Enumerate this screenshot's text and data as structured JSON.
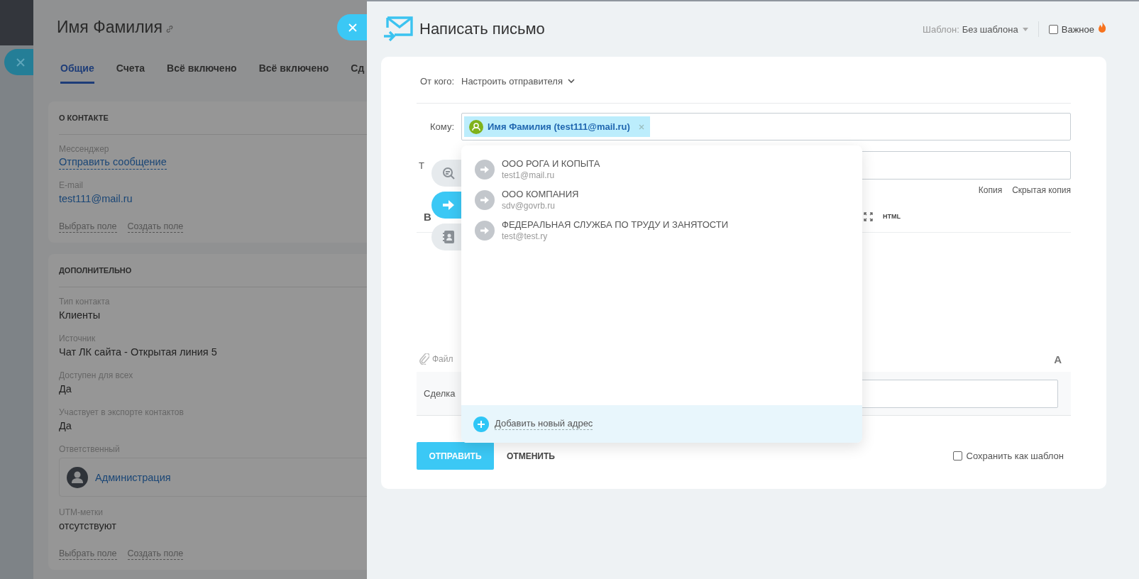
{
  "contact": {
    "title": "Имя Фамилия",
    "tabs": [
      {
        "label": "Общие",
        "selected": true
      },
      {
        "label": "Счета",
        "selected": false
      },
      {
        "label": "Всё включено",
        "selected": false
      },
      {
        "label": "Всё включено",
        "selected": false
      },
      {
        "label": "Сд",
        "selected": false
      }
    ],
    "sections": [
      {
        "title": "О КОНТАКТЕ",
        "fields": [
          {
            "label": "Мессенджер",
            "value": "Отправить сообщение",
            "kind": "action"
          },
          {
            "label": "E-mail",
            "value": "test111@mail.ru",
            "kind": "link"
          }
        ],
        "actions": [
          "Выбрать поле",
          "Создать поле"
        ]
      },
      {
        "title": "ДОПОЛНИТЕЛЬНО",
        "fields": [
          {
            "label": "Тип контакта",
            "value": "Клиенты",
            "kind": "text"
          },
          {
            "label": "Источник",
            "value": "Чат ЛК сайта - Открытая линия 5",
            "kind": "text"
          },
          {
            "label": "Доступен для всех",
            "value": "Да",
            "kind": "text"
          },
          {
            "label": "Участвует в экспорте контактов",
            "value": "Да",
            "kind": "text"
          },
          {
            "label": "Ответственный",
            "value": "Администрация",
            "kind": "user"
          },
          {
            "label": "UTM-метки",
            "value": "отсутствуют",
            "kind": "text"
          }
        ],
        "actions": [
          "Выбрать поле",
          "Создать поле"
        ]
      }
    ]
  },
  "email_form": {
    "title": "Написать письмо",
    "template_label": "Шаблон:",
    "template_value": "Без шаблона",
    "important": {
      "label": "Важное",
      "checked": false
    },
    "from_label": "От кого:",
    "from_value": "Настроить отправителя",
    "to_label": "Кому:",
    "recipients": [
      {
        "name": "Имя Фамилия (test111@mail.ru)"
      }
    ],
    "subject_label": "Т",
    "cc_links": [
      "Копия",
      "Скрытая копия"
    ],
    "toolbar_bold": "B",
    "toolbar_html": "HTML",
    "attach_label": "Файл",
    "font_button": "A",
    "deal_label": "Сделка",
    "send": "ОТПРАВИТЬ",
    "cancel": "ОТМЕНИТЬ",
    "save_template": {
      "label": "Сохранить как шаблон",
      "checked": false
    },
    "side_actions": [
      {
        "kind": "search",
        "selected": false
      },
      {
        "kind": "send",
        "selected": true
      },
      {
        "kind": "contacts",
        "selected": false
      }
    ],
    "suggestions": {
      "items": [
        {
          "name": "ООО РОГА И КОПЫТА",
          "email": "test1@mail.ru"
        },
        {
          "name": "ООО КОМПАНИЯ",
          "email": "sdv@govrb.ru"
        },
        {
          "name": "ФЕДЕРАЛЬНАЯ СЛУЖБА ПО ТРУДУ И ЗАНЯТОСТИ",
          "email": "test@test.ry"
        }
      ],
      "add_label": "Добавить новый адрес"
    }
  }
}
